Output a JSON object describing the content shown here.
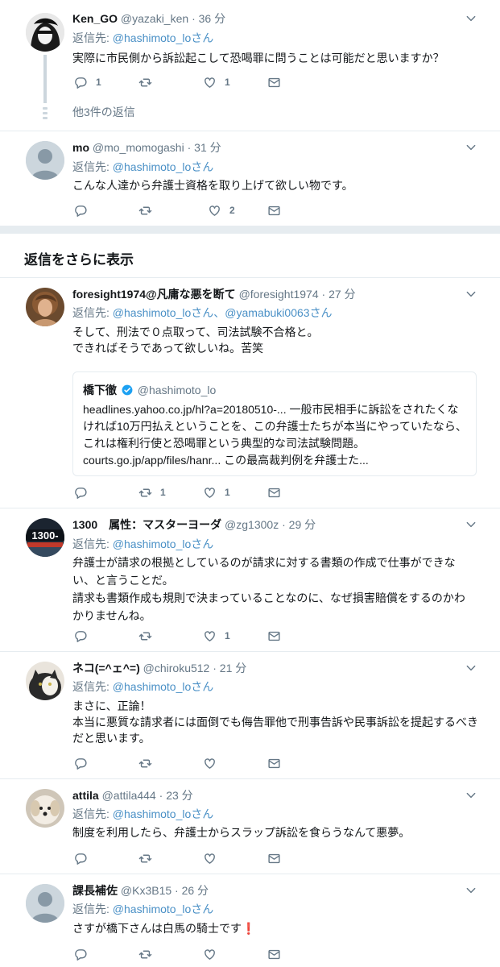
{
  "tweets": [
    {
      "name": "Ken_GO",
      "handle": "@yazaki_ken",
      "dot": "·",
      "time": "36 分",
      "replyto_prefix": "返信先: ",
      "replyto_link": "@hashimoto_lo",
      "replyto_suffix": "さん",
      "text": [
        "実際に市民側から訴訟起こして恐喝罪に問うことは可能だと思いますか？"
      ],
      "counts": {
        "reply": "1",
        "retweet": "",
        "like": "1"
      },
      "more_replies": "他3件の返信"
    },
    {
      "name": "mo",
      "handle": "@mo_momogashi",
      "dot": "·",
      "time": "31 分",
      "replyto_prefix": "返信先: ",
      "replyto_link": "@hashimoto_lo",
      "replyto_suffix": "さん",
      "text": [
        "こんな人達から弁護士資格を取り上げて欲しい物です。"
      ],
      "counts": {
        "reply": "",
        "retweet": "",
        "like": "2"
      }
    },
    {
      "name": "foresight1974@凡庸な悪を断て",
      "handle": "@foresight1974",
      "dot": "·",
      "time": "27 分",
      "replyto_prefix": "返信先: ",
      "replyto_link": "@hashimoto_lo",
      "replyto_mid": "さん、",
      "replyto_link2": "@yamabuki0063",
      "replyto_suffix": "さん",
      "text": [
        "そして、刑法で０点取って、司法試験不合格と。",
        "できればそうであって欲しいね。苦笑"
      ],
      "quote": {
        "name": "橋下徹",
        "handle": "@hashimoto_lo",
        "text": "headlines.yahoo.co.jp/hl?a=20180510-... 一般市民相手に訴訟をされたくなければ10万円払えということを、この弁護士たちが本当にやっていたなら、これは権利行使と恐喝罪という典型的な司法試験問題。courts.go.jp/app/files/hanr... この最高裁判例を弁護士た..."
      },
      "counts": {
        "reply": "",
        "retweet": "1",
        "like": "1"
      }
    },
    {
      "name": "1300　属性：マスターヨーダ",
      "handle": "@zg1300z",
      "dot": "·",
      "time": "29 分",
      "replyto_prefix": "返信先: ",
      "replyto_link": "@hashimoto_lo",
      "replyto_suffix": "さん",
      "text": [
        "弁護士が請求の根拠としているのが請求に対する書類の作成で仕事ができない、と言うことだ。",
        "請求も書類作成も規則で決まっていることなのに、なぜ損害賠償をするのかわかりませんね。"
      ],
      "counts": {
        "reply": "",
        "retweet": "",
        "like": "1"
      }
    },
    {
      "name": "ネコ(=^ェ^=)",
      "handle": "@chiroku512",
      "dot": "·",
      "time": "21 分",
      "replyto_prefix": "返信先: ",
      "replyto_link": "@hashimoto_lo",
      "replyto_suffix": "さん",
      "text": [
        "まさに、正論！",
        "本当に悪質な請求者には面倒でも侮告罪他で刑事告訴や民事訴訟を提起するべきだと思います。"
      ],
      "counts": {
        "reply": "",
        "retweet": "",
        "like": ""
      }
    },
    {
      "name": "attila",
      "handle": "@attila444",
      "dot": "·",
      "time": "23 分",
      "replyto_prefix": "返信先: ",
      "replyto_link": "@hashimoto_lo",
      "replyto_suffix": "さん",
      "text": [
        "制度を利用したら、弁護士からスラップ訴訟を食らうなんて悪夢。"
      ],
      "counts": {
        "reply": "",
        "retweet": "",
        "like": ""
      }
    },
    {
      "name": "課長補佐",
      "handle": "@Kx3B15",
      "dot": "·",
      "time": "26 分",
      "replyto_prefix": "返信先: ",
      "replyto_link": "@hashimoto_lo",
      "replyto_suffix": "さん",
      "text": [
        "さすが橋下さんは白馬の騎士です"
      ],
      "text_mark": "❗",
      "counts": {
        "reply": "",
        "retweet": "",
        "like": ""
      }
    }
  ],
  "show_more_label": "返信をさらに表示",
  "avatar_badge_1300": "1300-",
  "colors": {
    "link": "#4a90c6",
    "muted": "#657786",
    "divider": "#e6ecf0",
    "verified": "#1da1f2"
  },
  "icons": [
    "reply-icon",
    "retweet-icon",
    "like-icon",
    "dm-icon",
    "caret-down-icon",
    "verified-icon"
  ]
}
